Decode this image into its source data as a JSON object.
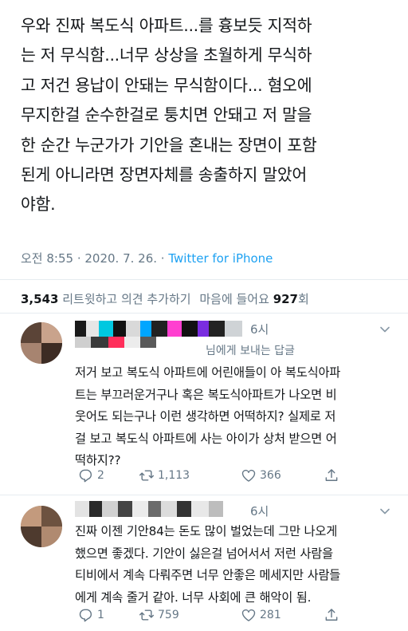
{
  "tweet": {
    "text": "우와 진짜 복도식 아파트...를 흉보듯 지적하\n는 저 무식함...너무 상상을 초월하게 무식하\n고 저건 용납이 안돼는 무식함이다... 혐오에\n무지한걸 순수한걸로 퉁치면 안돼고 저 말을\n한 순간 누군가가 기안을 혼내는 장면이 포함\n된게 아니라면 장면자체를 송출하지 말았어\n야함.",
    "time": "오전 8:55",
    "sep": " · ",
    "date": "2020. 7. 26.",
    "source": "Twitter for iPhone",
    "retweets": "3,543",
    "retweets_label": " 리트윗하고 의견 추가하기",
    "likes_label": "마음에 들어요 ",
    "likes": "927",
    "likes_unit": "회"
  },
  "replies": [
    {
      "time": "6시",
      "replying_to_name": "님에게 보내는 답글",
      "text": "저거 보고 복도식 아파트에 어린애들이 아 복도식아파\n트는 부끄러운거구나 혹은 복도식아파트가 나오면 비\n웃어도 되는구나 이런 생각하면 어떡하지? 실제로 저\n걸 보고 복도식 아파트에 사는 아이가 상처 받으면 어\n떡하지??",
      "replies": "2",
      "retweets": "1,113",
      "likes": "366"
    },
    {
      "time": "6시",
      "text": "진짜 이젠 기안84는 돈도 많이 벌었는데 그만 나오게\n했으면 좋겠다. 기안이 싫은걸 넘어서서 저런 사람을\n티비에서 계속 다뤄주면 너무 안좋은 메세지만 사람들\n에게 계속 줄거 같아. 너무 사회에 큰 해악이 됨.",
      "replies": "1",
      "retweets": "759",
      "likes": "281"
    }
  ],
  "colors": {
    "text": "#14171a",
    "secondary": "#657786",
    "accent": "#1da1f2",
    "divider": "#e6ecf0"
  },
  "icons": [
    "reply-icon",
    "retweet-icon",
    "like-icon",
    "share-icon",
    "chevron-down-icon"
  ]
}
